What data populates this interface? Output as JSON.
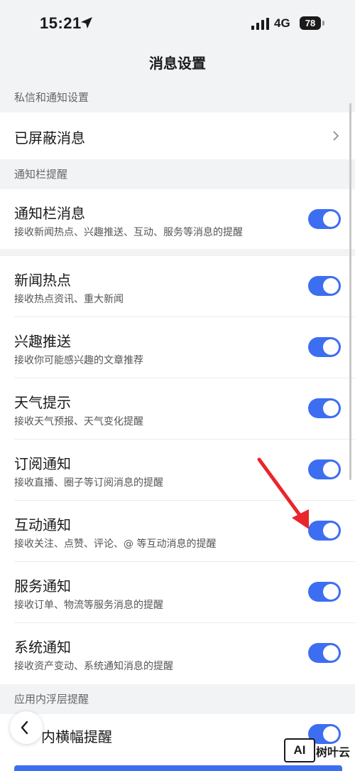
{
  "status_bar": {
    "time": "15:21",
    "network": "4G",
    "battery": "78"
  },
  "nav": {
    "title": "消息设置"
  },
  "sections": {
    "private": "私信和通知设置",
    "notify_bar": "通知栏提醒",
    "in_app": "应用内浮层提醒"
  },
  "blocked": {
    "label": "已屏蔽消息"
  },
  "notify_bar_item": {
    "title": "通知栏消息",
    "subtitle": "接收新闻热点、兴趣推送、互动、服务等消息的提醒",
    "enabled": true
  },
  "items": [
    {
      "title": "新闻热点",
      "subtitle": "接收热点资讯、重大新闻",
      "enabled": true
    },
    {
      "title": "兴趣推送",
      "subtitle": "接收你可能感兴趣的文章推荐",
      "enabled": true
    },
    {
      "title": "天气提示",
      "subtitle": "接收天气预报、天气变化提醒",
      "enabled": true
    },
    {
      "title": "订阅通知",
      "subtitle": "接收直播、圈子等订阅消息的提醒",
      "enabled": true
    },
    {
      "title": "互动通知",
      "subtitle": "接收关注、点赞、评论、@ 等互动消息的提醒",
      "enabled": true
    },
    {
      "title": "服务通知",
      "subtitle": "接收订单、物流等服务消息的提醒",
      "enabled": true
    },
    {
      "title": "系统通知",
      "subtitle": "接收资产变动、系统通知消息的提醒",
      "enabled": true
    }
  ],
  "in_app_item": {
    "title": "内横幅提醒",
    "enabled": true
  },
  "watermark": {
    "logo": "AI",
    "text": "树叶云"
  },
  "colors": {
    "accent": "#3d6ef2",
    "background": "#f2f3f5",
    "arrow": "#e8262b"
  }
}
